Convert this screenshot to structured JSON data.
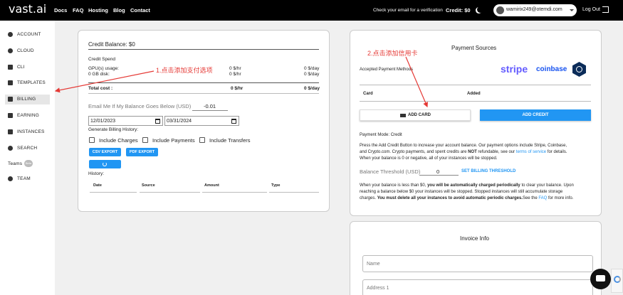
{
  "topbar": {
    "logo": "vast.ai",
    "nav": [
      "Docs",
      "FAQ",
      "Hosting",
      "Blog",
      "Contact"
    ],
    "message": "Check your email for a verification",
    "credit": "Credit: $0",
    "user_email": "wamirix249@otemdi.com",
    "logout": "Log Out"
  },
  "sidebar": {
    "items": [
      {
        "label": "ACCOUNT",
        "icon": "account-icon"
      },
      {
        "label": "CLOUD",
        "icon": "cloud-icon"
      },
      {
        "label": "CLI",
        "icon": "terminal-icon"
      },
      {
        "label": "TEMPLATES",
        "icon": "template-icon"
      },
      {
        "label": "BILLING",
        "icon": "billing-icon"
      },
      {
        "label": "EARNING",
        "icon": "earning-icon"
      },
      {
        "label": "INSTANCES",
        "icon": "instances-icon"
      },
      {
        "label": "SEARCH",
        "icon": "search-icon"
      },
      {
        "label": "Teams",
        "icon": "teams-icon",
        "badge": "Beta"
      },
      {
        "label": "TEAM",
        "icon": "team-icon"
      }
    ],
    "active": "BILLING"
  },
  "billing": {
    "balance_title": "Credit Balance: $0",
    "spend_title": "Credit Spend",
    "rows": [
      {
        "label": "GPU(s) usage:",
        "hr": "0 $/hr",
        "day": "0 $/day"
      },
      {
        "label": "0 GB disk:",
        "hr": "0 $/hr",
        "day": "0 $/day"
      }
    ],
    "total": {
      "label": "Total cost :",
      "hr": "0 $/hr",
      "day": "0 $/day"
    },
    "email_label": "Email Me If My Balance Goes Below (USD)",
    "email_value": "-0.01",
    "date_from": "12/01/2023",
    "date_to": "03/31/2024",
    "history_label": "Generate Billing History:",
    "include_charges": "Include Charges",
    "include_payments": "Include Payments",
    "include_transfers": "Include Transfers",
    "csv_export": "CSV EXPORT",
    "pdf_export": "PDF EXPORT",
    "history_title": "History:",
    "history_columns": [
      "Date",
      "Source",
      "Amount",
      "Type"
    ]
  },
  "payment": {
    "title": "Payment Sources",
    "accepted_label": "Accepted Payment Methods",
    "logos": {
      "stripe": "stripe",
      "coinbase": "coinbase"
    },
    "columns": [
      "Card",
      "Added"
    ],
    "add_card": "ADD CARD",
    "add_credit": "ADD CREDIT",
    "mode": "Payment Mode: Credit",
    "desc": {
      "p1": "Press the Add Credit Button to increase your account balance. Our payment options include Stripe, Coinbase,",
      "p2a": "and Crypto.com. Crypto payments, and spent credits are ",
      "p2_not": "NOT",
      "p2b": " refundable, see our ",
      "p2_link": "terms of service",
      "p2c": " for details.",
      "p3": "When your balance is 0 or negative, all of your instances will be stopped."
    },
    "threshold_label": "Balance Threshold (USD)",
    "threshold_value": "0",
    "threshold_button": "SET BILLING THRESHOLD",
    "warn": {
      "a1": "When your balance is less than $0, ",
      "a1_bold": "you will be automatically charged periodically",
      "a1_end": " to clear your balance. Upon",
      "a2": "reaching a balance below $0 your instances will be stopped. Stopped instances will still accumulate storage",
      "a3a": "charges. ",
      "a3_bold": "You must delete all your instances to avoid automatic periodic charges.",
      "a3b": "See the ",
      "a3_link": "FAQ",
      "a3c": " for more info."
    }
  },
  "invoice": {
    "title": "Invoice Info",
    "name_placeholder": "Name",
    "address_placeholder": "Address 1"
  },
  "annotations": {
    "a1": "1.点击添加支付选项",
    "a2": "2.点击添加信用卡"
  },
  "colors": {
    "accent": "#2196f3",
    "annotation": "#e53935",
    "topbar": "#000000"
  }
}
